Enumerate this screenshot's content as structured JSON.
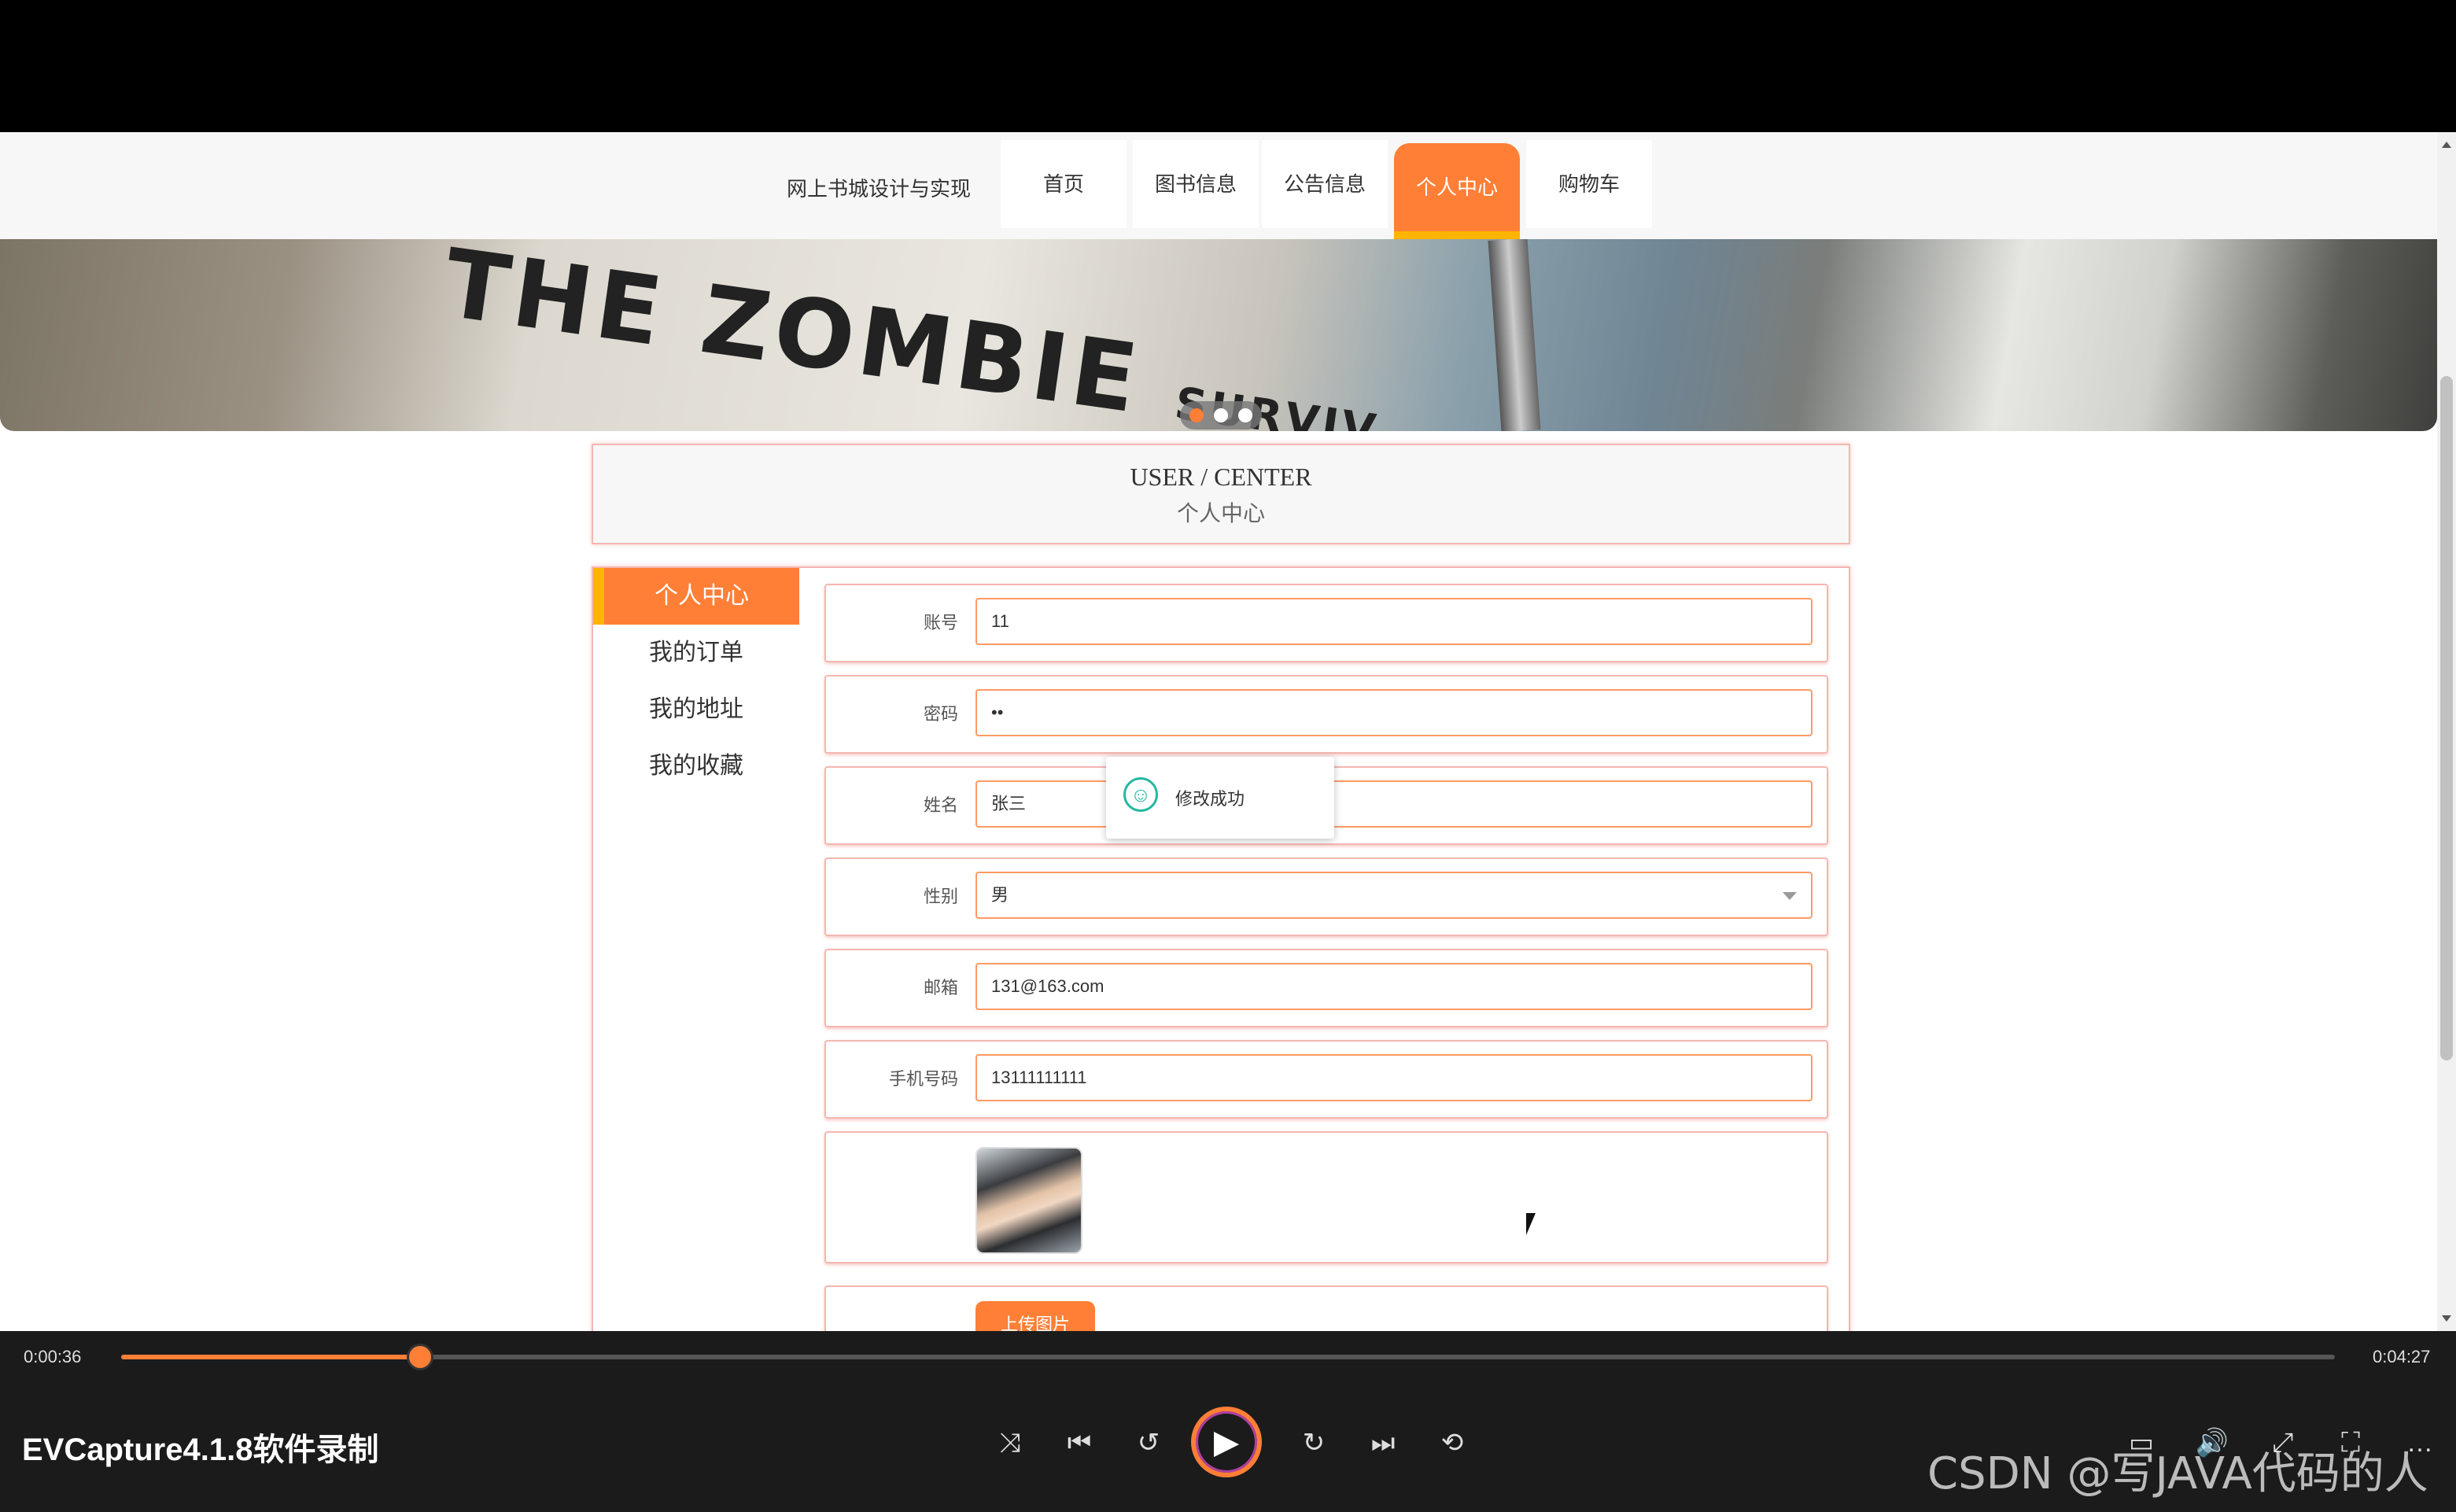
{
  "site": {
    "title": "网上书城设计与实现",
    "nav": [
      {
        "label": "首页"
      },
      {
        "label": "图书信息"
      },
      {
        "label": "公告信息"
      },
      {
        "label": "个人中心"
      },
      {
        "label": "购物车"
      }
    ],
    "active_nav": "个人中心"
  },
  "banner": {
    "book_text": "THE ZOMBIE",
    "book_text_small": "SURVIV",
    "slides": 3,
    "active_slide": 1
  },
  "user_center": {
    "title_en": "USER / CENTER",
    "title_cn": "个人中心"
  },
  "side_menu": [
    {
      "label": "个人中心"
    },
    {
      "label": "我的订单"
    },
    {
      "label": "我的地址"
    },
    {
      "label": "我的收藏"
    }
  ],
  "form": {
    "account_label": "账号",
    "account_value": "11",
    "password_label": "密码",
    "password_value": "••",
    "name_label": "姓名",
    "name_value": "张三",
    "gender_label": "性别",
    "gender_value": "男",
    "email_label": "邮箱",
    "email_value": "131@163.com",
    "phone_label": "手机号码",
    "phone_value": "13111111111",
    "upload_label": "上传图片"
  },
  "toast": {
    "message": "修改成功",
    "icon": "smile-icon"
  },
  "player": {
    "current_time": "0:00:36",
    "total_time": "0:04:27",
    "progress_fraction": 0.135,
    "app_title": "EVCapture4.1.8软件录制",
    "controls": [
      "shuffle-icon",
      "previous-icon",
      "rewind-10-icon",
      "play-icon",
      "forward-30-icon",
      "next-icon",
      "repeat-icon"
    ],
    "right_controls": [
      "subtitle-icon",
      "volume-icon",
      "expand-icon",
      "fullscreen-icon",
      "more-icon"
    ]
  },
  "watermark": "CSDN @写JAVA代码的人",
  "colors": {
    "accent": "#ff7f36",
    "accent_border": "#ffb400",
    "field_border": "#ff9a63",
    "success": "#25b7a0"
  }
}
